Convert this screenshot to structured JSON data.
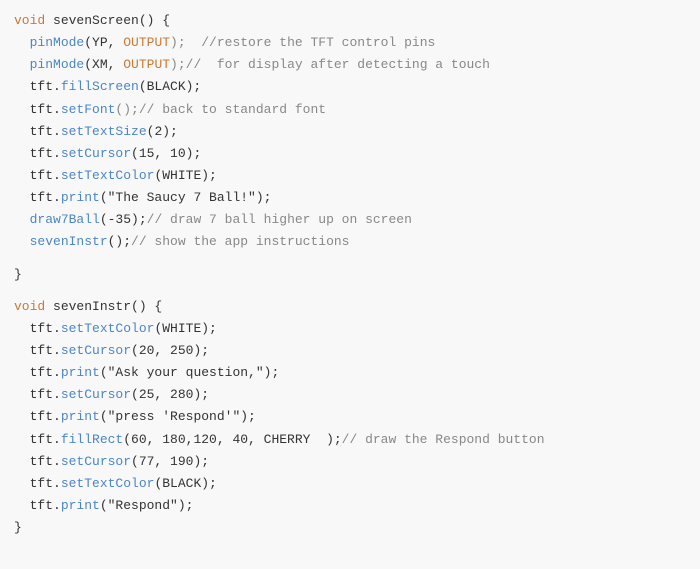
{
  "code": {
    "lines": [
      {
        "id": 1,
        "parts": [
          {
            "text": "void ",
            "color": "keyword"
          },
          {
            "text": "sevenScreen",
            "color": "default"
          },
          {
            "text": "() {",
            "color": "default"
          }
        ]
      },
      {
        "id": 2,
        "parts": [
          {
            "text": "  ",
            "color": "default"
          },
          {
            "text": "pinMode",
            "color": "method"
          },
          {
            "text": "(YP, ",
            "color": "default"
          },
          {
            "text": "OUTPUT",
            "color": "param-keyword"
          },
          {
            "text": ");  //restore the TFT control pins",
            "color": "comment"
          }
        ]
      },
      {
        "id": 3,
        "parts": [
          {
            "text": "  ",
            "color": "default"
          },
          {
            "text": "pinMode",
            "color": "method"
          },
          {
            "text": "(XM, ",
            "color": "default"
          },
          {
            "text": "OUTPUT",
            "color": "param-keyword"
          },
          {
            "text": ");//  for display after detecting a touch",
            "color": "comment"
          }
        ]
      },
      {
        "id": 4,
        "parts": [
          {
            "text": "  tft.",
            "color": "default"
          },
          {
            "text": "fillScreen",
            "color": "method"
          },
          {
            "text": "(BLACK);",
            "color": "default"
          }
        ]
      },
      {
        "id": 5,
        "parts": [
          {
            "text": "  tft.",
            "color": "default"
          },
          {
            "text": "setFont",
            "color": "method"
          },
          {
            "text": "();// back to standard font",
            "color": "comment"
          }
        ]
      },
      {
        "id": 6,
        "parts": [
          {
            "text": "  tft.",
            "color": "default"
          },
          {
            "text": "setTextSize",
            "color": "method"
          },
          {
            "text": "(2);",
            "color": "default"
          }
        ]
      },
      {
        "id": 7,
        "parts": [
          {
            "text": "  tft.",
            "color": "default"
          },
          {
            "text": "setCursor",
            "color": "method"
          },
          {
            "text": "(15, 10);",
            "color": "default"
          }
        ]
      },
      {
        "id": 8,
        "parts": [
          {
            "text": "  tft.",
            "color": "default"
          },
          {
            "text": "setTextColor",
            "color": "method"
          },
          {
            "text": "(WHITE);",
            "color": "default"
          }
        ]
      },
      {
        "id": 9,
        "parts": [
          {
            "text": "  tft.",
            "color": "default"
          },
          {
            "text": "print",
            "color": "method"
          },
          {
            "text": "(\"The Saucy 7 Ball!\");",
            "color": "default"
          }
        ]
      },
      {
        "id": 10,
        "parts": [
          {
            "text": "  draw7Ball(-35);// draw 7 ball higher up on screen",
            "color": "comment-line"
          }
        ]
      },
      {
        "id": 11,
        "parts": [
          {
            "text": "  sevenInstr();// show the app instructions",
            "color": "comment-line"
          }
        ]
      },
      {
        "id": 12,
        "blank": true
      },
      {
        "id": 13,
        "parts": [
          {
            "text": "}",
            "color": "default"
          }
        ]
      },
      {
        "id": 14,
        "blank": true
      },
      {
        "id": 15,
        "parts": [
          {
            "text": "void ",
            "color": "keyword"
          },
          {
            "text": "sevenInstr",
            "color": "default"
          },
          {
            "text": "() {",
            "color": "default"
          }
        ]
      },
      {
        "id": 16,
        "parts": [
          {
            "text": "  tft.",
            "color": "default"
          },
          {
            "text": "setTextColor",
            "color": "method"
          },
          {
            "text": "(WHITE);",
            "color": "default"
          }
        ]
      },
      {
        "id": 17,
        "parts": [
          {
            "text": "  tft.",
            "color": "default"
          },
          {
            "text": "setCursor",
            "color": "method"
          },
          {
            "text": "(20, 250);",
            "color": "default"
          }
        ]
      },
      {
        "id": 18,
        "parts": [
          {
            "text": "  tft.",
            "color": "default"
          },
          {
            "text": "print",
            "color": "method"
          },
          {
            "text": "(\"Ask your question,\");",
            "color": "default"
          }
        ]
      },
      {
        "id": 19,
        "parts": [
          {
            "text": "  tft.",
            "color": "default"
          },
          {
            "text": "setCursor",
            "color": "method"
          },
          {
            "text": "(25, 280);",
            "color": "default"
          }
        ]
      },
      {
        "id": 20,
        "parts": [
          {
            "text": "  tft.",
            "color": "default"
          },
          {
            "text": "print",
            "color": "method"
          },
          {
            "text": "(\"press 'Respond'\");",
            "color": "default"
          }
        ]
      },
      {
        "id": 21,
        "parts": [
          {
            "text": "  tft.",
            "color": "default"
          },
          {
            "text": "fillRect",
            "color": "method"
          },
          {
            "text": "(60, 180,120, 40, CHERRY  );// draw the Respond button",
            "color": "comment-inline"
          }
        ]
      },
      {
        "id": 22,
        "parts": [
          {
            "text": "  tft.",
            "color": "default"
          },
          {
            "text": "setCursor",
            "color": "method"
          },
          {
            "text": "(77, 190);",
            "color": "default"
          }
        ]
      },
      {
        "id": 23,
        "parts": [
          {
            "text": "  tft.",
            "color": "default"
          },
          {
            "text": "setTextColor",
            "color": "method"
          },
          {
            "text": "(BLACK);",
            "color": "default"
          }
        ]
      },
      {
        "id": 24,
        "parts": [
          {
            "text": "  tft.",
            "color": "default"
          },
          {
            "text": "print",
            "color": "method"
          },
          {
            "text": "(\"Respond\");",
            "color": "default"
          }
        ]
      },
      {
        "id": 25,
        "parts": [
          {
            "text": "}",
            "color": "default"
          }
        ]
      }
    ]
  }
}
